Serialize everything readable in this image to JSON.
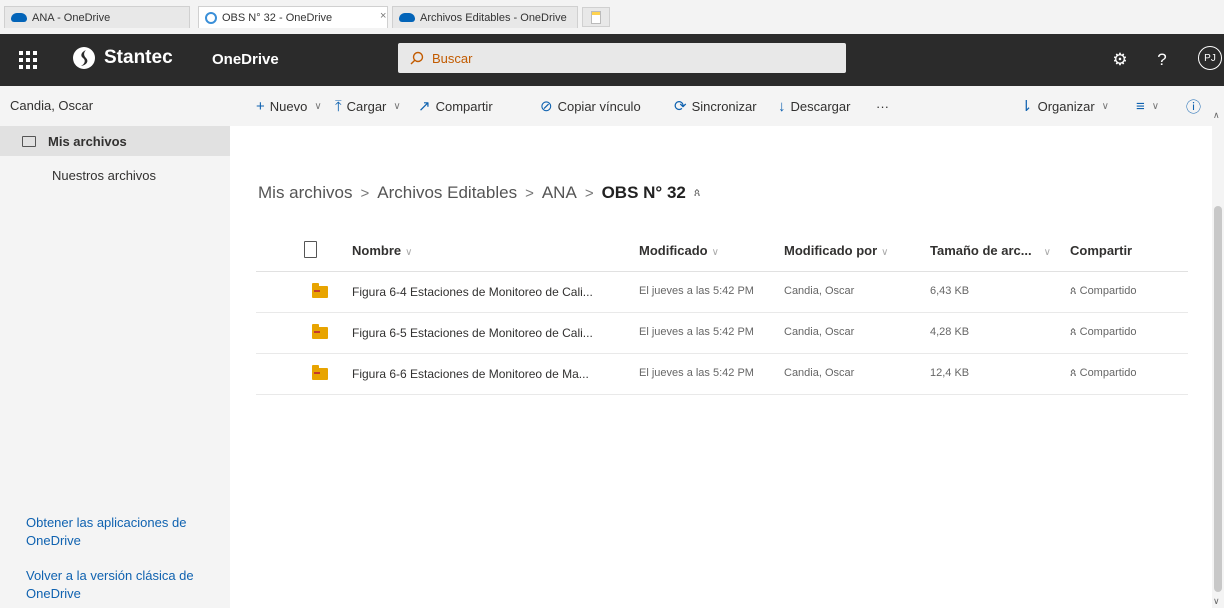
{
  "browser": {
    "tabs": [
      {
        "title": "ANA - OneDrive"
      },
      {
        "title": "OBS N° 32 - OneDrive"
      },
      {
        "title": "Archivos Editables - OneDrive"
      }
    ],
    "close_glyph": "×"
  },
  "suitebar": {
    "brand": "Stantec",
    "app": "OneDrive",
    "search_placeholder": "Buscar",
    "help": "?",
    "avatar_initials": "PJ"
  },
  "leftnav": {
    "user": "Candia, Oscar",
    "items": [
      {
        "label": "Mis archivos"
      },
      {
        "label": "Nuestros archivos"
      }
    ],
    "links": [
      {
        "label": "Obtener las aplicaciones de OneDrive"
      },
      {
        "label": "Volver a la versión clásica de OneDrive"
      }
    ]
  },
  "commands": {
    "nuevo": "Nuevo",
    "cargar": "Cargar",
    "compartir": "Compartir",
    "copiar": "Copiar vínculo",
    "sincronizar": "Sincronizar",
    "descargar": "Descargar",
    "more": "···",
    "organizar": "Organizar"
  },
  "breadcrumb": {
    "items": [
      "Mis archivos",
      "Archivos Editables",
      "ANA"
    ],
    "current": "OBS N° 32",
    "separator": ">"
  },
  "table": {
    "headers": {
      "name": "Nombre",
      "modified": "Modificado",
      "modified_by": "Modificado por",
      "size": "Tamaño de arc...",
      "share": "Compartir"
    },
    "rows": [
      {
        "name": "Figura 6-4 Estaciones de Monitoreo de Cali...",
        "modified": "El jueves a las 5:42 PM",
        "modified_by": "Candia, Oscar",
        "size": "6,43 KB",
        "share": "Compartido"
      },
      {
        "name": "Figura 6-5 Estaciones de Monitoreo de Cali...",
        "modified": "El jueves a las 5:42 PM",
        "modified_by": "Candia, Oscar",
        "size": "4,28 KB",
        "share": "Compartido"
      },
      {
        "name": "Figura 6-6 Estaciones de Monitoreo de Ma...",
        "modified": "El jueves a las 5:42 PM",
        "modified_by": "Candia, Oscar",
        "size": "12,4 KB",
        "share": "Compartido"
      }
    ]
  },
  "colors": {
    "suitebar": "#2b2b2b",
    "accent": "#0f62b0",
    "folder": "#e8a400"
  }
}
